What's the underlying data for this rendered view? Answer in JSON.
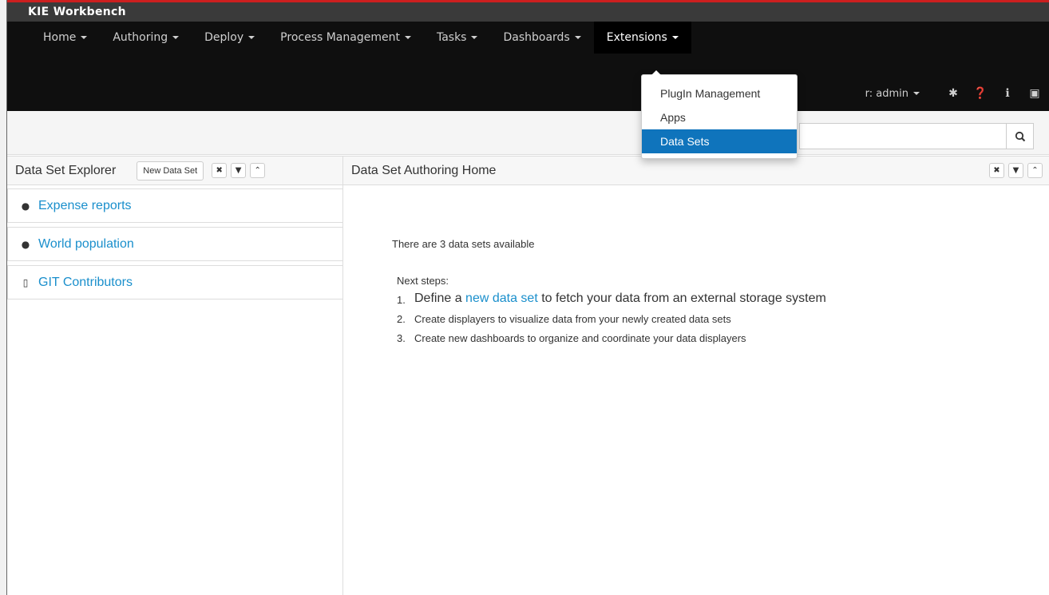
{
  "app": {
    "brand": "KIE Workbench"
  },
  "nav": {
    "menus": [
      {
        "label": "Home"
      },
      {
        "label": "Authoring"
      },
      {
        "label": "Deploy"
      },
      {
        "label": "Process Management"
      },
      {
        "label": "Tasks"
      },
      {
        "label": "Dashboards"
      },
      {
        "label": "Extensions"
      }
    ],
    "user_label": "r: admin",
    "icons": [
      "gear-icon",
      "question-icon",
      "info-icon",
      "briefcase-icon"
    ]
  },
  "extensions_menu": {
    "items": [
      {
        "label": "PlugIn Management"
      },
      {
        "label": "Apps"
      },
      {
        "label": "Data Sets",
        "selected": true
      }
    ]
  },
  "toolbar": {
    "search_icon": "search-icon"
  },
  "explorer": {
    "title": "Data Set Explorer",
    "new_button": "New Data Set",
    "items": [
      {
        "label": "Expense reports",
        "icon": "csv-icon"
      },
      {
        "label": "World population",
        "icon": "csv-icon"
      },
      {
        "label": "GIT Contributors",
        "icon": "file-icon"
      }
    ]
  },
  "home": {
    "title": "Data Set Authoring Home",
    "summary": "There are 3 data sets available",
    "next_steps_label": "Next steps:",
    "steps": [
      {
        "num": "1.",
        "prefix": "Define a ",
        "link": "new data set",
        "suffix": " to fetch your data from an external storage system"
      },
      {
        "num": "2.",
        "text": "Create displayers to visualize data from your newly created data sets"
      },
      {
        "num": "3.",
        "text": "Create new dashboards to organize and coordinate your data displayers"
      }
    ]
  },
  "colors": {
    "accent": "#1a8fcc",
    "selected": "#0f74bc",
    "navbar": "#0f0f0f",
    "brandbar": "#3a3a3a",
    "topline": "#cc1f1f"
  }
}
